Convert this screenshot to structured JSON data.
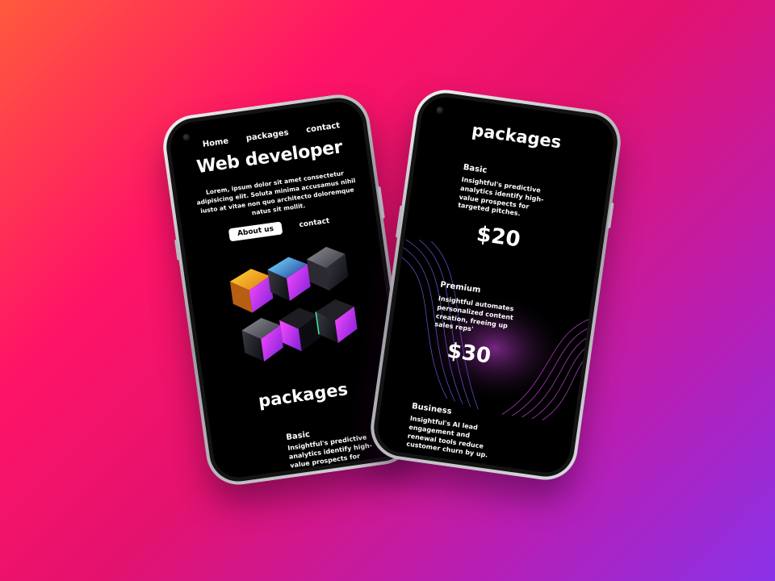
{
  "colors": {
    "bg_start": "#ff5a3c",
    "bg_mid": "#ff1466",
    "bg_end": "#8a32e8",
    "screen_bg": "#000000",
    "wave_purple": "#8b5cf6",
    "wave_pink": "#d946ef"
  },
  "left_phone": {
    "nav": {
      "home": "Home",
      "packages": "packages",
      "contact": "contact"
    },
    "hero": {
      "title": "Web developer",
      "text": "Lorem, ipsum dolor sit amet consectetur adipisicing elit. Soluta minima accusamus nihil iusto at vitae non quo architecto doloremque natus sit mollit."
    },
    "cta": {
      "about": "About us",
      "contact": "contact"
    },
    "packages_title": "packages",
    "basic": {
      "name": "Basic",
      "desc": "Insightful's predictive analytics identify high-value prospects for targeted pitches."
    }
  },
  "right_phone": {
    "packages_title": "packages",
    "basic": {
      "name": "Basic",
      "desc": "Insightful's predictive analytics identify high-value prospects for targeted pitches.",
      "price": "$20"
    },
    "premium": {
      "name": "Premium",
      "desc": "Insightful automates personalized content creation, freeing up sales reps'",
      "price": "$30"
    },
    "business": {
      "name": "Business",
      "desc": "Insightful's AI lead engagement and renewal tools reduce customer churn by up."
    }
  }
}
